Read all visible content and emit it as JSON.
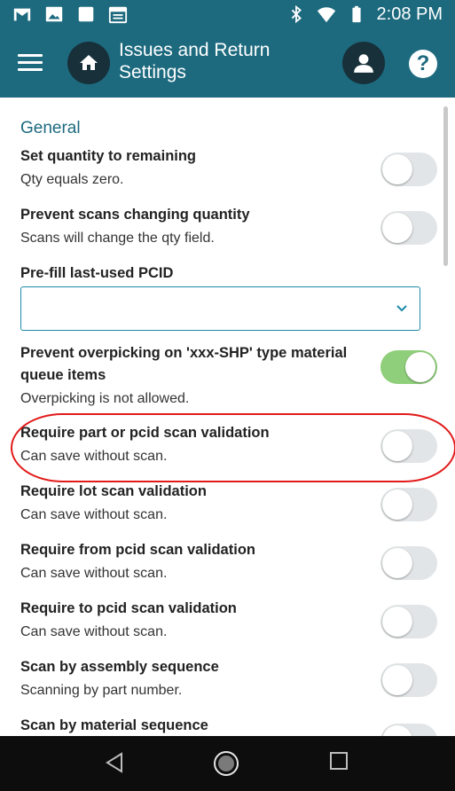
{
  "status_bar": {
    "time": "2:08 PM",
    "left_icons": [
      "gmail-icon",
      "image-icon",
      "square-icon",
      "calendar-icon"
    ],
    "right_icons": [
      "bluetooth-icon",
      "wifi-icon",
      "battery-icon"
    ]
  },
  "app_bar": {
    "title": "Issues and Return Settings",
    "help_label": "?"
  },
  "section": {
    "title": "General"
  },
  "settings": [
    {
      "label": "Set quantity to remaining",
      "desc": "Qty equals zero.",
      "on": false
    },
    {
      "label": "Prevent scans changing quantity",
      "desc": "Scans will change the qty field.",
      "on": false
    },
    {
      "label": "Pre-fill last-used PCID",
      "value": ""
    },
    {
      "label": "Prevent overpicking on 'xxx-SHP' type material queue items",
      "desc": "Overpicking is not allowed.",
      "on": true
    },
    {
      "label": "Require part or pcid scan validation",
      "desc": "Can save without scan.",
      "on": false
    },
    {
      "label": "Require lot scan validation",
      "desc": "Can save without scan.",
      "on": false
    },
    {
      "label": "Require from pcid scan validation",
      "desc": "Can save without scan.",
      "on": false
    },
    {
      "label": "Require to pcid scan validation",
      "desc": "Can save without scan.",
      "on": false
    },
    {
      "label": "Scan by assembly sequence",
      "desc": "Scanning by part number.",
      "on": false
    },
    {
      "label": "Scan by material sequence",
      "desc": "",
      "on": false
    }
  ],
  "colors": {
    "brand": "#1d6a7f",
    "toggle_on": "#8fce7a",
    "toggle_off": "#e2e5e7",
    "annotation": "#e21a1a"
  }
}
